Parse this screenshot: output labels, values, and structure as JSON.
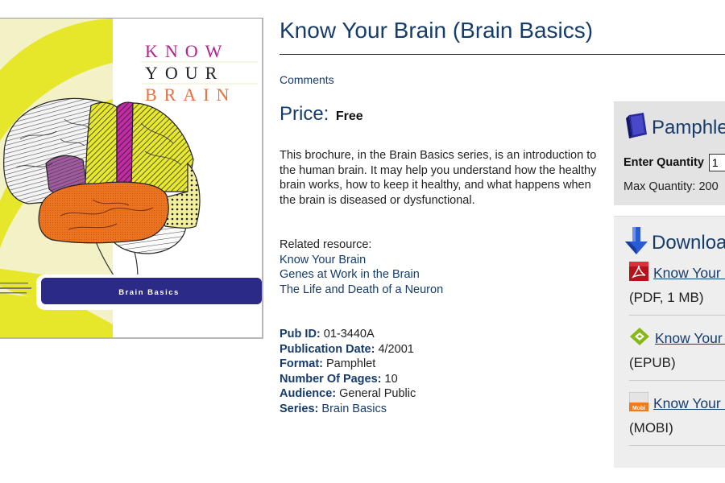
{
  "cover": {
    "alt": "Know Your Brain cover",
    "title_lines": [
      "KNOW",
      "YOUR",
      "BRAIN"
    ],
    "banner": "Brain Basics",
    "colors": {
      "know": "#b2238e",
      "your": "#222222",
      "brain": "#e8703a",
      "banner": "#2b2a86",
      "yellow": "#e6e62a",
      "pale_yellow": "#f3f2c6"
    }
  },
  "page": {
    "title": "Know Your Brain (Brain Basics)",
    "comments_link": "Comments",
    "price_label": "Price:",
    "price_value": "Free",
    "description": "This brochure, in the Brain Basics series, is an introduction to the human brain. It may help you understand how the healthy brain works, how to keep it healthy, and what happens when the brain is diseased or dysfunctional.",
    "related": {
      "label": "Related resource:",
      "links": [
        "Know Your Brain",
        "Genes at Work in the Brain",
        "The Life and Death of a Neuron"
      ]
    },
    "meta": [
      {
        "key": "Pub ID:",
        "value": "01-3440A"
      },
      {
        "key": "Publication Date:",
        "value": "4/2001"
      },
      {
        "key": "Format:",
        "value": "Pamphlet"
      },
      {
        "key": "Number Of Pages:",
        "value": "10"
      },
      {
        "key": "Audience:",
        "value": "General Public"
      },
      {
        "key": "Series:",
        "value": "Brain Basics"
      }
    ]
  },
  "order_panel": {
    "icon": "book-icon",
    "title": "Pamphlet",
    "qty_label": "Enter Quantity",
    "qty_value": "1",
    "max_qty": "Max Quantity: 200"
  },
  "download_panel": {
    "icon": "download-arrow-icon",
    "title": "Download",
    "items": [
      {
        "icon": "pdf-icon",
        "label": "Know Your Brain",
        "meta": "(PDF, 1 MB)"
      },
      {
        "icon": "epub-icon",
        "label": "Know Your Brain",
        "meta": "(EPUB)"
      },
      {
        "icon": "mobi-icon",
        "label": "Know Your Brain",
        "meta": "(MOBI)"
      }
    ]
  }
}
